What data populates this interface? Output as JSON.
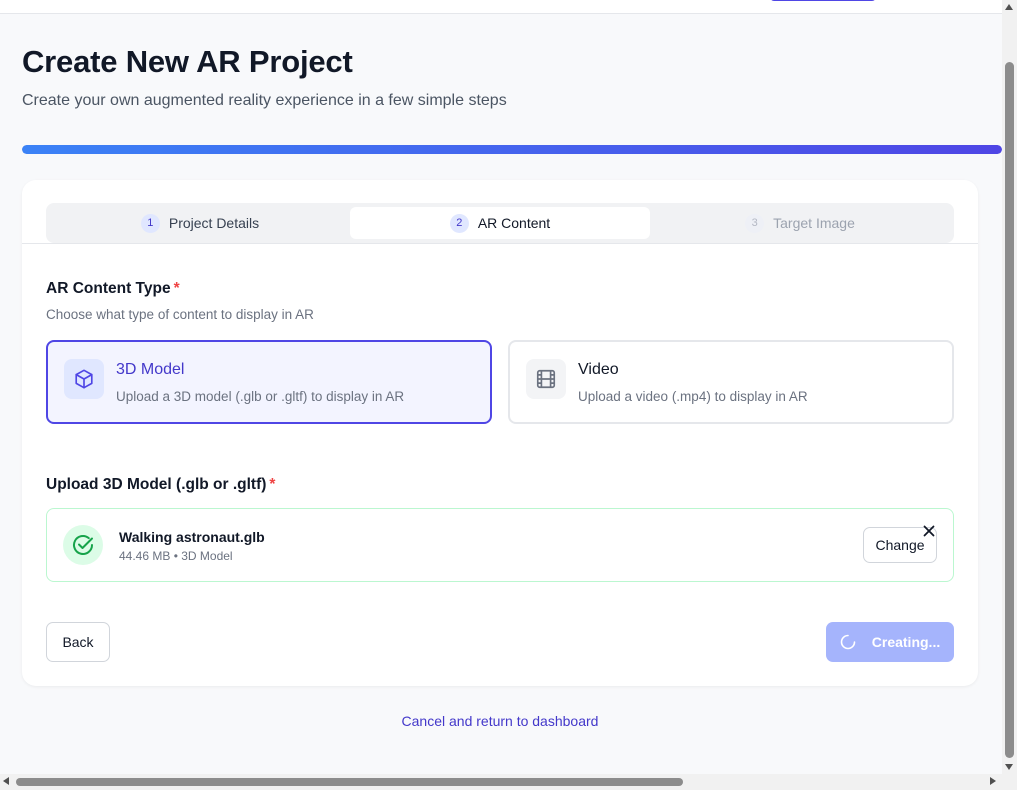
{
  "header": {
    "title": "Create New AR Project",
    "subtitle": "Create your own augmented reality experience in a few simple steps"
  },
  "progress": {
    "percent": 100
  },
  "tabs": [
    {
      "number": "1",
      "label": "Project Details",
      "state": "completed"
    },
    {
      "number": "2",
      "label": "AR Content",
      "state": "active"
    },
    {
      "number": "3",
      "label": "Target Image",
      "state": "disabled"
    }
  ],
  "content_type": {
    "label": "AR Content Type",
    "required_mark": "*",
    "hint": "Choose what type of content to display in AR",
    "options": [
      {
        "title": "3D Model",
        "description": "Upload a 3D model (.glb or .gltf) to display in AR",
        "icon": "cube-icon",
        "selected": true
      },
      {
        "title": "Video",
        "description": "Upload a video (.mp4) to display in AR",
        "icon": "film-icon",
        "selected": false
      }
    ]
  },
  "upload": {
    "label": "Upload 3D Model (.glb or .gltf)",
    "required_mark": "*",
    "file_name": "Walking astronaut.glb",
    "file_meta": "44.46 MB • 3D Model",
    "change_label": "Change",
    "remove_icon": "close-icon"
  },
  "actions": {
    "back_label": "Back",
    "create_label": "Creating...",
    "cancel_label": "Cancel and return to dashboard"
  },
  "colors": {
    "accent": "#4f46e5",
    "accent_light": "#a5b4fc",
    "success": "#16a34a",
    "required": "#ef4444"
  }
}
